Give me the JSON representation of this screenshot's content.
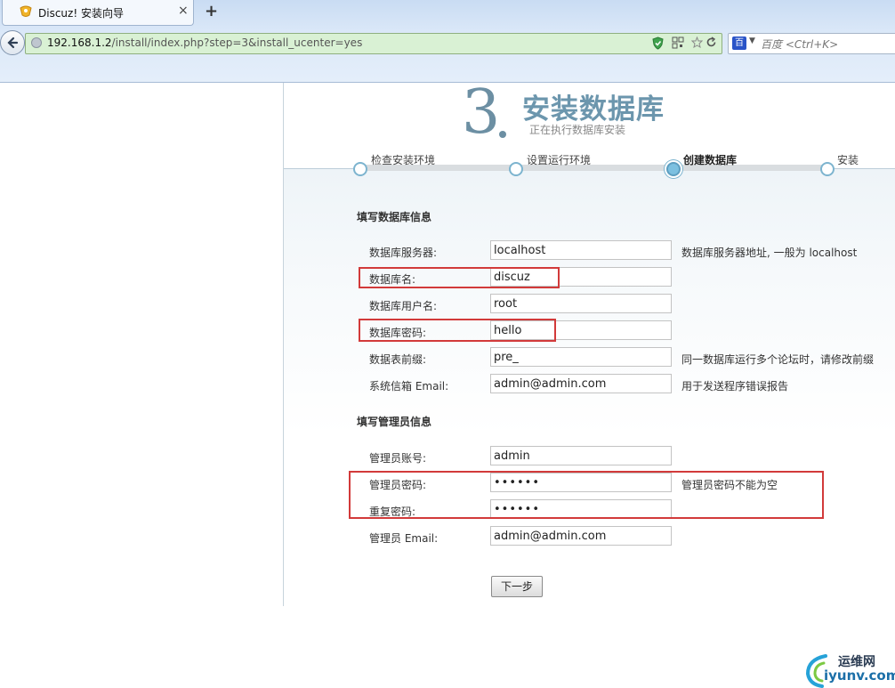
{
  "browser": {
    "tab_title": "Discuz! 安装向导",
    "tab_close": "×",
    "new_tab": "+",
    "url_host": "192.168.1.2",
    "url_path": "/install/index.php?step=3&install_ucenter=yes",
    "search_engine_icon": "baidu-paw-icon",
    "search_engine_label": "百",
    "search_placeholder": "百度 <Ctrl+K>"
  },
  "header": {
    "step_number": "3",
    "title": "安装数据库",
    "subtitle": "正在执行数据库安装"
  },
  "steps": [
    {
      "label": "检查安装环境",
      "active": false
    },
    {
      "label": "设置运行环境",
      "active": false
    },
    {
      "label": "创建数据库",
      "active": true
    },
    {
      "label": "安装",
      "active": false
    }
  ],
  "db_section": {
    "title": "填写数据库信息",
    "fields": [
      {
        "label": "数据库服务器:",
        "value": "localhost",
        "hint": "数据库服务器地址, 一般为 localhost"
      },
      {
        "label": "数据库名:",
        "value": "discuz",
        "hint": ""
      },
      {
        "label": "数据库用户名:",
        "value": "root",
        "hint": ""
      },
      {
        "label": "数据库密码:",
        "value": "hello",
        "hint": ""
      },
      {
        "label": "数据表前缀:",
        "value": "pre_",
        "hint": "同一数据库运行多个论坛时，请修改前缀"
      },
      {
        "label": "系统信箱 Email:",
        "value": "admin@admin.com",
        "hint": "用于发送程序错误报告"
      }
    ]
  },
  "admin_section": {
    "title": "填写管理员信息",
    "fields": [
      {
        "label": "管理员账号:",
        "value": "admin",
        "hint": ""
      },
      {
        "label": "管理员密码:",
        "value": "••••••",
        "hint": "管理员密码不能为空"
      },
      {
        "label": "重复密码:",
        "value": "••••••",
        "hint": ""
      },
      {
        "label": "管理员 Email:",
        "value": "admin@admin.com",
        "hint": ""
      }
    ]
  },
  "next_button": "下一步",
  "watermark": {
    "cn": "运维网",
    "en": "iyunv.com"
  },
  "colors": {
    "highlight": "#d23a3a",
    "title": "#6c96ad",
    "url_bar_bg": "#d9f1d4"
  }
}
